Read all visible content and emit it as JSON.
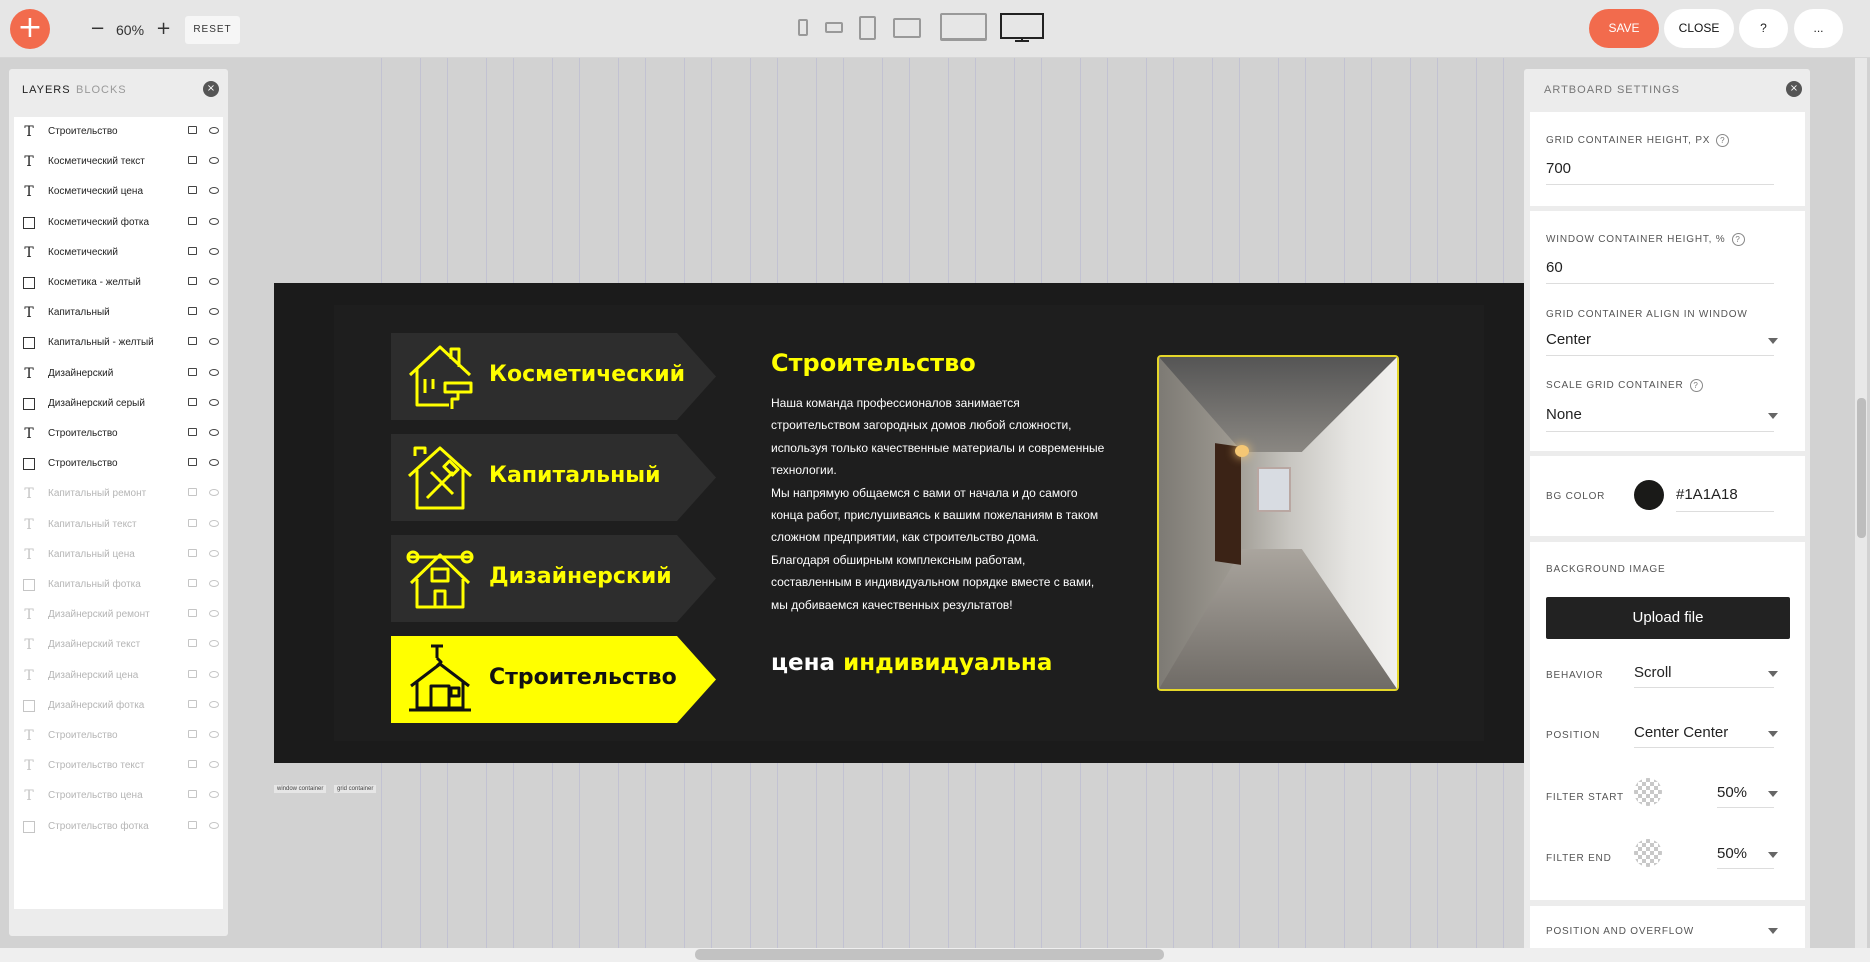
{
  "toolbar": {
    "add_label": "+",
    "zoom_minus": "−",
    "zoom_value": "60%",
    "zoom_plus": "+",
    "reset_label": "RESET",
    "save_label": "SAVE",
    "close_label": "CLOSE",
    "help_label": "?",
    "more_label": "...",
    "devices": [
      "phone-portrait-icon",
      "phone-landscape-icon",
      "tablet-portrait-icon",
      "tablet-landscape-icon",
      "laptop-icon",
      "desktop-icon"
    ],
    "accent_color": "#f26b4d"
  },
  "left_panel": {
    "tab_layers": "LAYERS",
    "tab_blocks": "BLOCKS",
    "close_label": "×",
    "layers": [
      {
        "type": "text",
        "name": "Строительство",
        "visible": true
      },
      {
        "type": "text",
        "name": "Косметический текст",
        "visible": true
      },
      {
        "type": "text",
        "name": "Косметический цена",
        "visible": true
      },
      {
        "type": "box",
        "name": "Косметический фотка",
        "visible": true
      },
      {
        "type": "text",
        "name": "Косметический",
        "visible": true
      },
      {
        "type": "box",
        "name": "Косметика - желтый",
        "visible": true
      },
      {
        "type": "text",
        "name": "Капитальный",
        "visible": true
      },
      {
        "type": "box",
        "name": "Капитальный - желтый",
        "visible": true
      },
      {
        "type": "text",
        "name": "Дизайнерский",
        "visible": true
      },
      {
        "type": "box",
        "name": "Дизайнерский серый",
        "visible": true
      },
      {
        "type": "text",
        "name": "Строительство",
        "visible": true
      },
      {
        "type": "box",
        "name": "Строительство",
        "visible": true
      },
      {
        "type": "text",
        "name": "Капитальный ремонт",
        "visible": false
      },
      {
        "type": "text",
        "name": "Капитальный текст",
        "visible": false
      },
      {
        "type": "text",
        "name": "Капитальный цена",
        "visible": false
      },
      {
        "type": "box",
        "name": "Капитальный фотка",
        "visible": false
      },
      {
        "type": "text",
        "name": "Дизайнерский ремонт",
        "visible": false
      },
      {
        "type": "text",
        "name": "Дизайнерский текст",
        "visible": false
      },
      {
        "type": "text",
        "name": "Дизайнерский цена",
        "visible": false
      },
      {
        "type": "box",
        "name": "Дизайнерский фотка",
        "visible": false
      },
      {
        "type": "text",
        "name": "Строительство",
        "visible": false
      },
      {
        "type": "text",
        "name": "Строительство текст",
        "visible": false
      },
      {
        "type": "text",
        "name": "Строительство цена",
        "visible": false
      },
      {
        "type": "box",
        "name": "Строительство фотка",
        "visible": false
      }
    ]
  },
  "artboard": {
    "bg_color": "#1a1a18",
    "accent_color": "#ffff00",
    "menu": [
      {
        "label": "Косметический",
        "icon": "house-paint-roller-icon",
        "active": false
      },
      {
        "label": "Капитальный",
        "icon": "house-tools-icon",
        "active": false
      },
      {
        "label": "Дизайнерский",
        "icon": "house-wrench-icon",
        "active": false
      },
      {
        "label": "Строительство",
        "icon": "house-crane-icon",
        "active": true
      }
    ],
    "title": "Строительство",
    "text": "Наша команда профессионалов занимается строительством загородных домов любой сложности, используя только качественные материалы и современные технологии.\nМы напрямую общаемся с вами от начала и до самого конца работ, прислушиваясь к вашим пожеланиям в таком сложном предприятии, как строительство дома.\nБлагодаря обширным комплексным работам, составленным в индивидуальном порядке вместе с вами, мы добиваемся качественных результатов!",
    "price_prefix": "цена",
    "price_value": "индивидуальна",
    "tags": [
      "window container",
      "grid container"
    ]
  },
  "right_panel": {
    "title": "ARTBOARD SETTINGS",
    "close_label": "×",
    "grid_height_label": "GRID CONTAINER HEIGHT, PX",
    "grid_height_value": "700",
    "window_height_label": "WINDOW CONTAINER HEIGHT, %",
    "window_height_value": "60",
    "align_label": "GRID CONTAINER ALIGN IN WINDOW",
    "align_value": "Center",
    "scale_label": "SCALE GRID CONTAINER",
    "scale_value": "None",
    "bg_color_label": "BG COLOR",
    "bg_color_value": "#1A1A18",
    "bg_image_label": "BACKGROUND IMAGE",
    "upload_label": "Upload file",
    "behavior_label": "BEHAVIOR",
    "behavior_value": "Scroll",
    "position_label": "POSITION",
    "position_value": "Center Center",
    "filter_start_label": "FILTER START",
    "filter_start_value": "50%",
    "filter_end_label": "FILTER END",
    "filter_end_value": "50%",
    "overflow_label": "POSITION AND OVERFLOW",
    "help_mark": "?"
  }
}
